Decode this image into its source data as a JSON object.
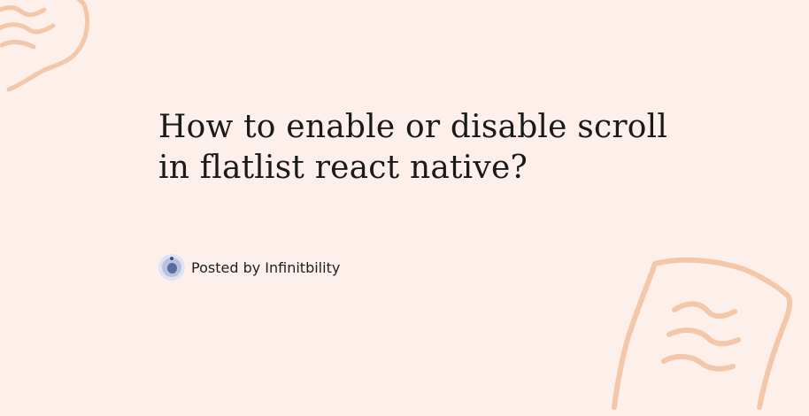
{
  "post": {
    "title_line_1": "How to enable or disable scroll",
    "title_line_2": "in flatlist react native?",
    "author_prefix": "Posted by",
    "author_name": "Infinitbility"
  },
  "decorations": {
    "top_left": "paper-note-icon",
    "bottom_right": "paper-note-icon",
    "color": "#f5c7a9"
  },
  "colors": {
    "background": "#fdf0eb",
    "text": "#1a1a1a",
    "avatar": "#5d6a9c"
  }
}
